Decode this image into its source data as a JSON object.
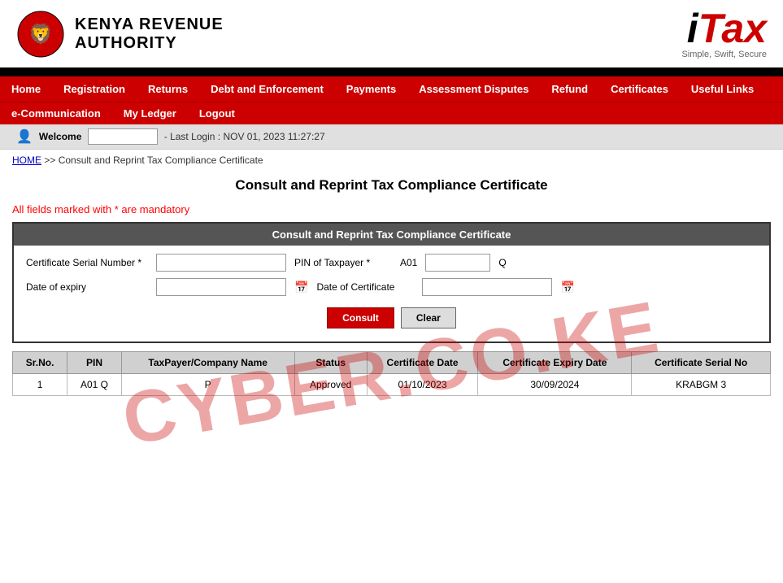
{
  "header": {
    "org_name_line1": "Kenya Revenue",
    "org_name_line2": "Authority",
    "itax_brand": "iTax",
    "itax_tagline": "Simple, Swift, Secure"
  },
  "nav": {
    "top_items": [
      "Home",
      "Registration",
      "Returns",
      "Debt and Enforcement",
      "Payments",
      "Assessment Disputes",
      "Refund",
      "Certificates",
      "Useful Links"
    ],
    "bottom_items": [
      "e-Communication",
      "My Ledger",
      "Logout"
    ]
  },
  "welcome_bar": {
    "label": "Welcome",
    "username": "",
    "last_login_label": "- Last Login : NOV 01, 2023 11:27:27"
  },
  "breadcrumb": {
    "home_label": "HOME",
    "path": ">> Consult and Reprint Tax Compliance Certificate"
  },
  "page": {
    "title": "Consult and Reprint Tax Compliance Certificate",
    "mandatory_note": "All fields marked with * are mandatory"
  },
  "form": {
    "panel_title": "Consult and Reprint Tax Compliance Certificate",
    "fields": {
      "cert_serial_label": "Certificate Serial Number *",
      "cert_serial_value": "",
      "pin_label": "PIN of Taxpayer *",
      "pin_prefix": "A01",
      "pin_suffix": "Q",
      "pin_value": "",
      "date_expiry_label": "Date of expiry",
      "date_expiry_value": "",
      "date_cert_label": "Date of Certificate",
      "date_cert_value": ""
    },
    "buttons": {
      "consult": "Consult",
      "clear": "Clear"
    }
  },
  "table": {
    "headers": [
      "Sr.No.",
      "PIN",
      "TaxPayer/Company Name",
      "Status",
      "Certificate Date",
      "Certificate Expiry Date",
      "Certificate Serial No"
    ],
    "rows": [
      {
        "sr_no": "1",
        "pin": "A01        Q",
        "company": "P",
        "status": "Approved",
        "cert_date": "01/10/2023",
        "expiry_date": "30/09/2024",
        "serial_no": "KRABGM        3"
      }
    ]
  },
  "watermark": {
    "text": "CYBER.CO.KE"
  }
}
